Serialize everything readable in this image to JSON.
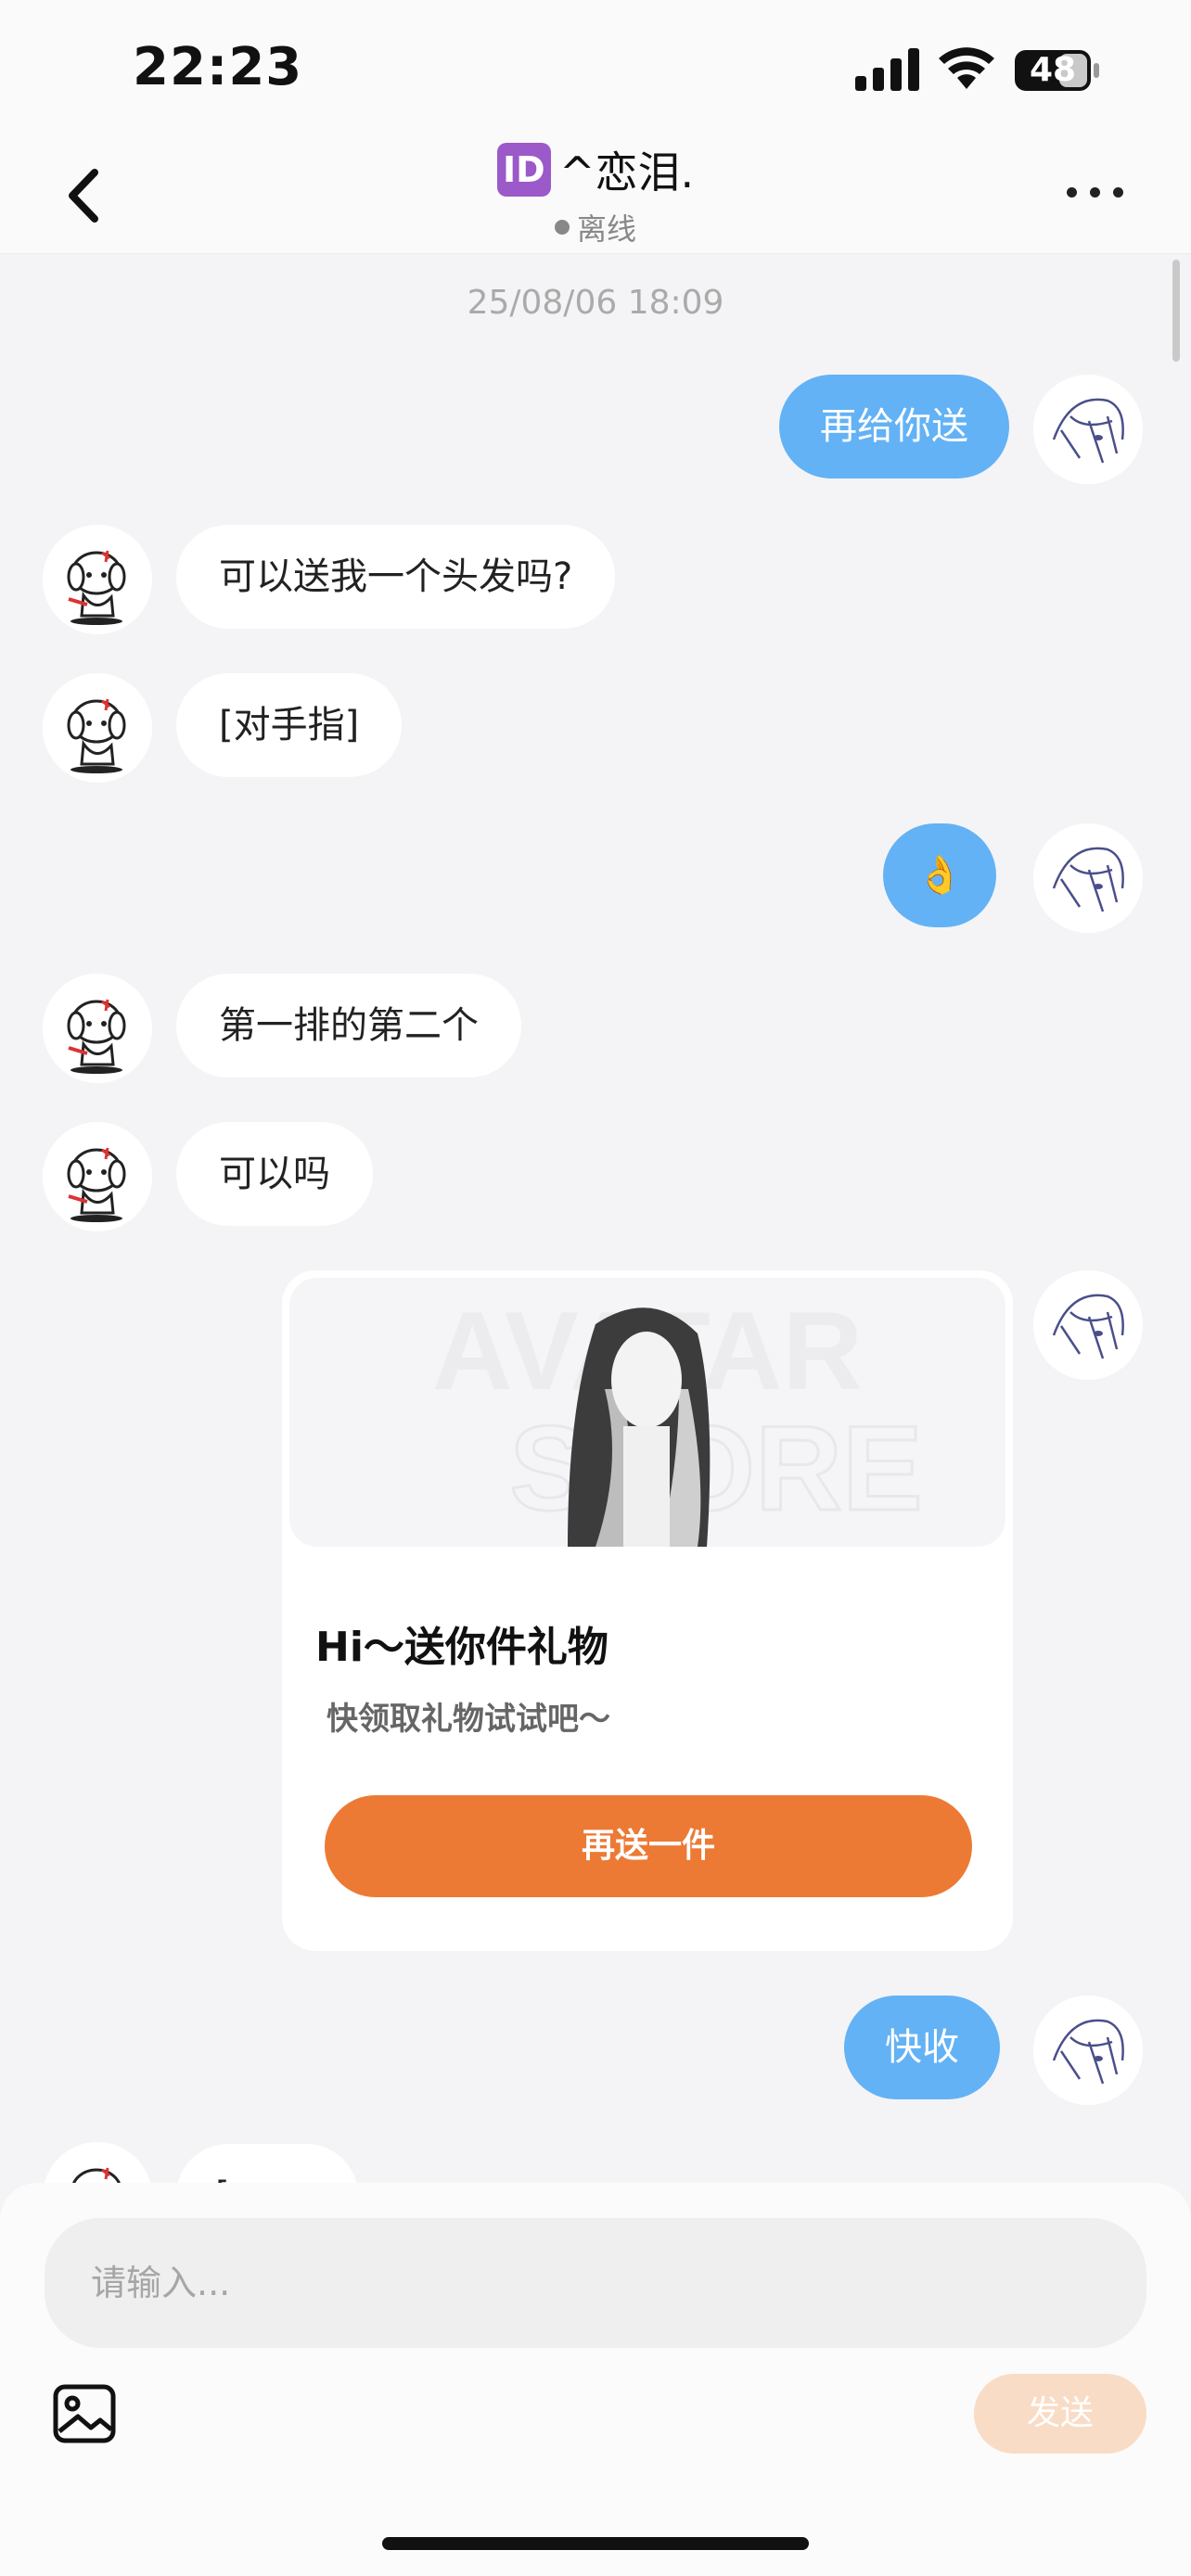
{
  "status_bar": {
    "time": "22:23",
    "battery_level": "48",
    "icons": [
      "signal-icon",
      "wifi-icon",
      "battery-icon"
    ]
  },
  "header": {
    "badge_text": "ID",
    "title": "^恋泪.",
    "presence": "离线",
    "icons": [
      "back-icon",
      "more-icon"
    ]
  },
  "chat": {
    "timestamp": "25/08/06 18:09",
    "messages": [
      {
        "side": "out",
        "text": "再给你送"
      },
      {
        "side": "in",
        "text": "可以送我一个头发吗?"
      },
      {
        "side": "in",
        "text": "[对手指]"
      },
      {
        "side": "out",
        "text": "👌"
      },
      {
        "side": "in",
        "text": "第一排的第二个"
      },
      {
        "side": "in",
        "text": "可以吗"
      },
      {
        "side": "out",
        "text": "快收"
      }
    ],
    "gift_card": {
      "title": "Hi～送你件礼物",
      "subtitle": "快领取礼物试试吧～",
      "button_label": "再送一件",
      "image_caption": "AVATAR STORE"
    },
    "partial_message": {
      "side": "in",
      "text": "[..."
    }
  },
  "composer": {
    "placeholder": "请输入...",
    "send_label": "发送",
    "icons": [
      "image-icon"
    ]
  },
  "colors": {
    "outgoing_bubble": "#63b2f5",
    "gift_button": "#ec7a35",
    "send_button_disabled": "#f9dcc6",
    "id_badge": "#9b59c9"
  }
}
